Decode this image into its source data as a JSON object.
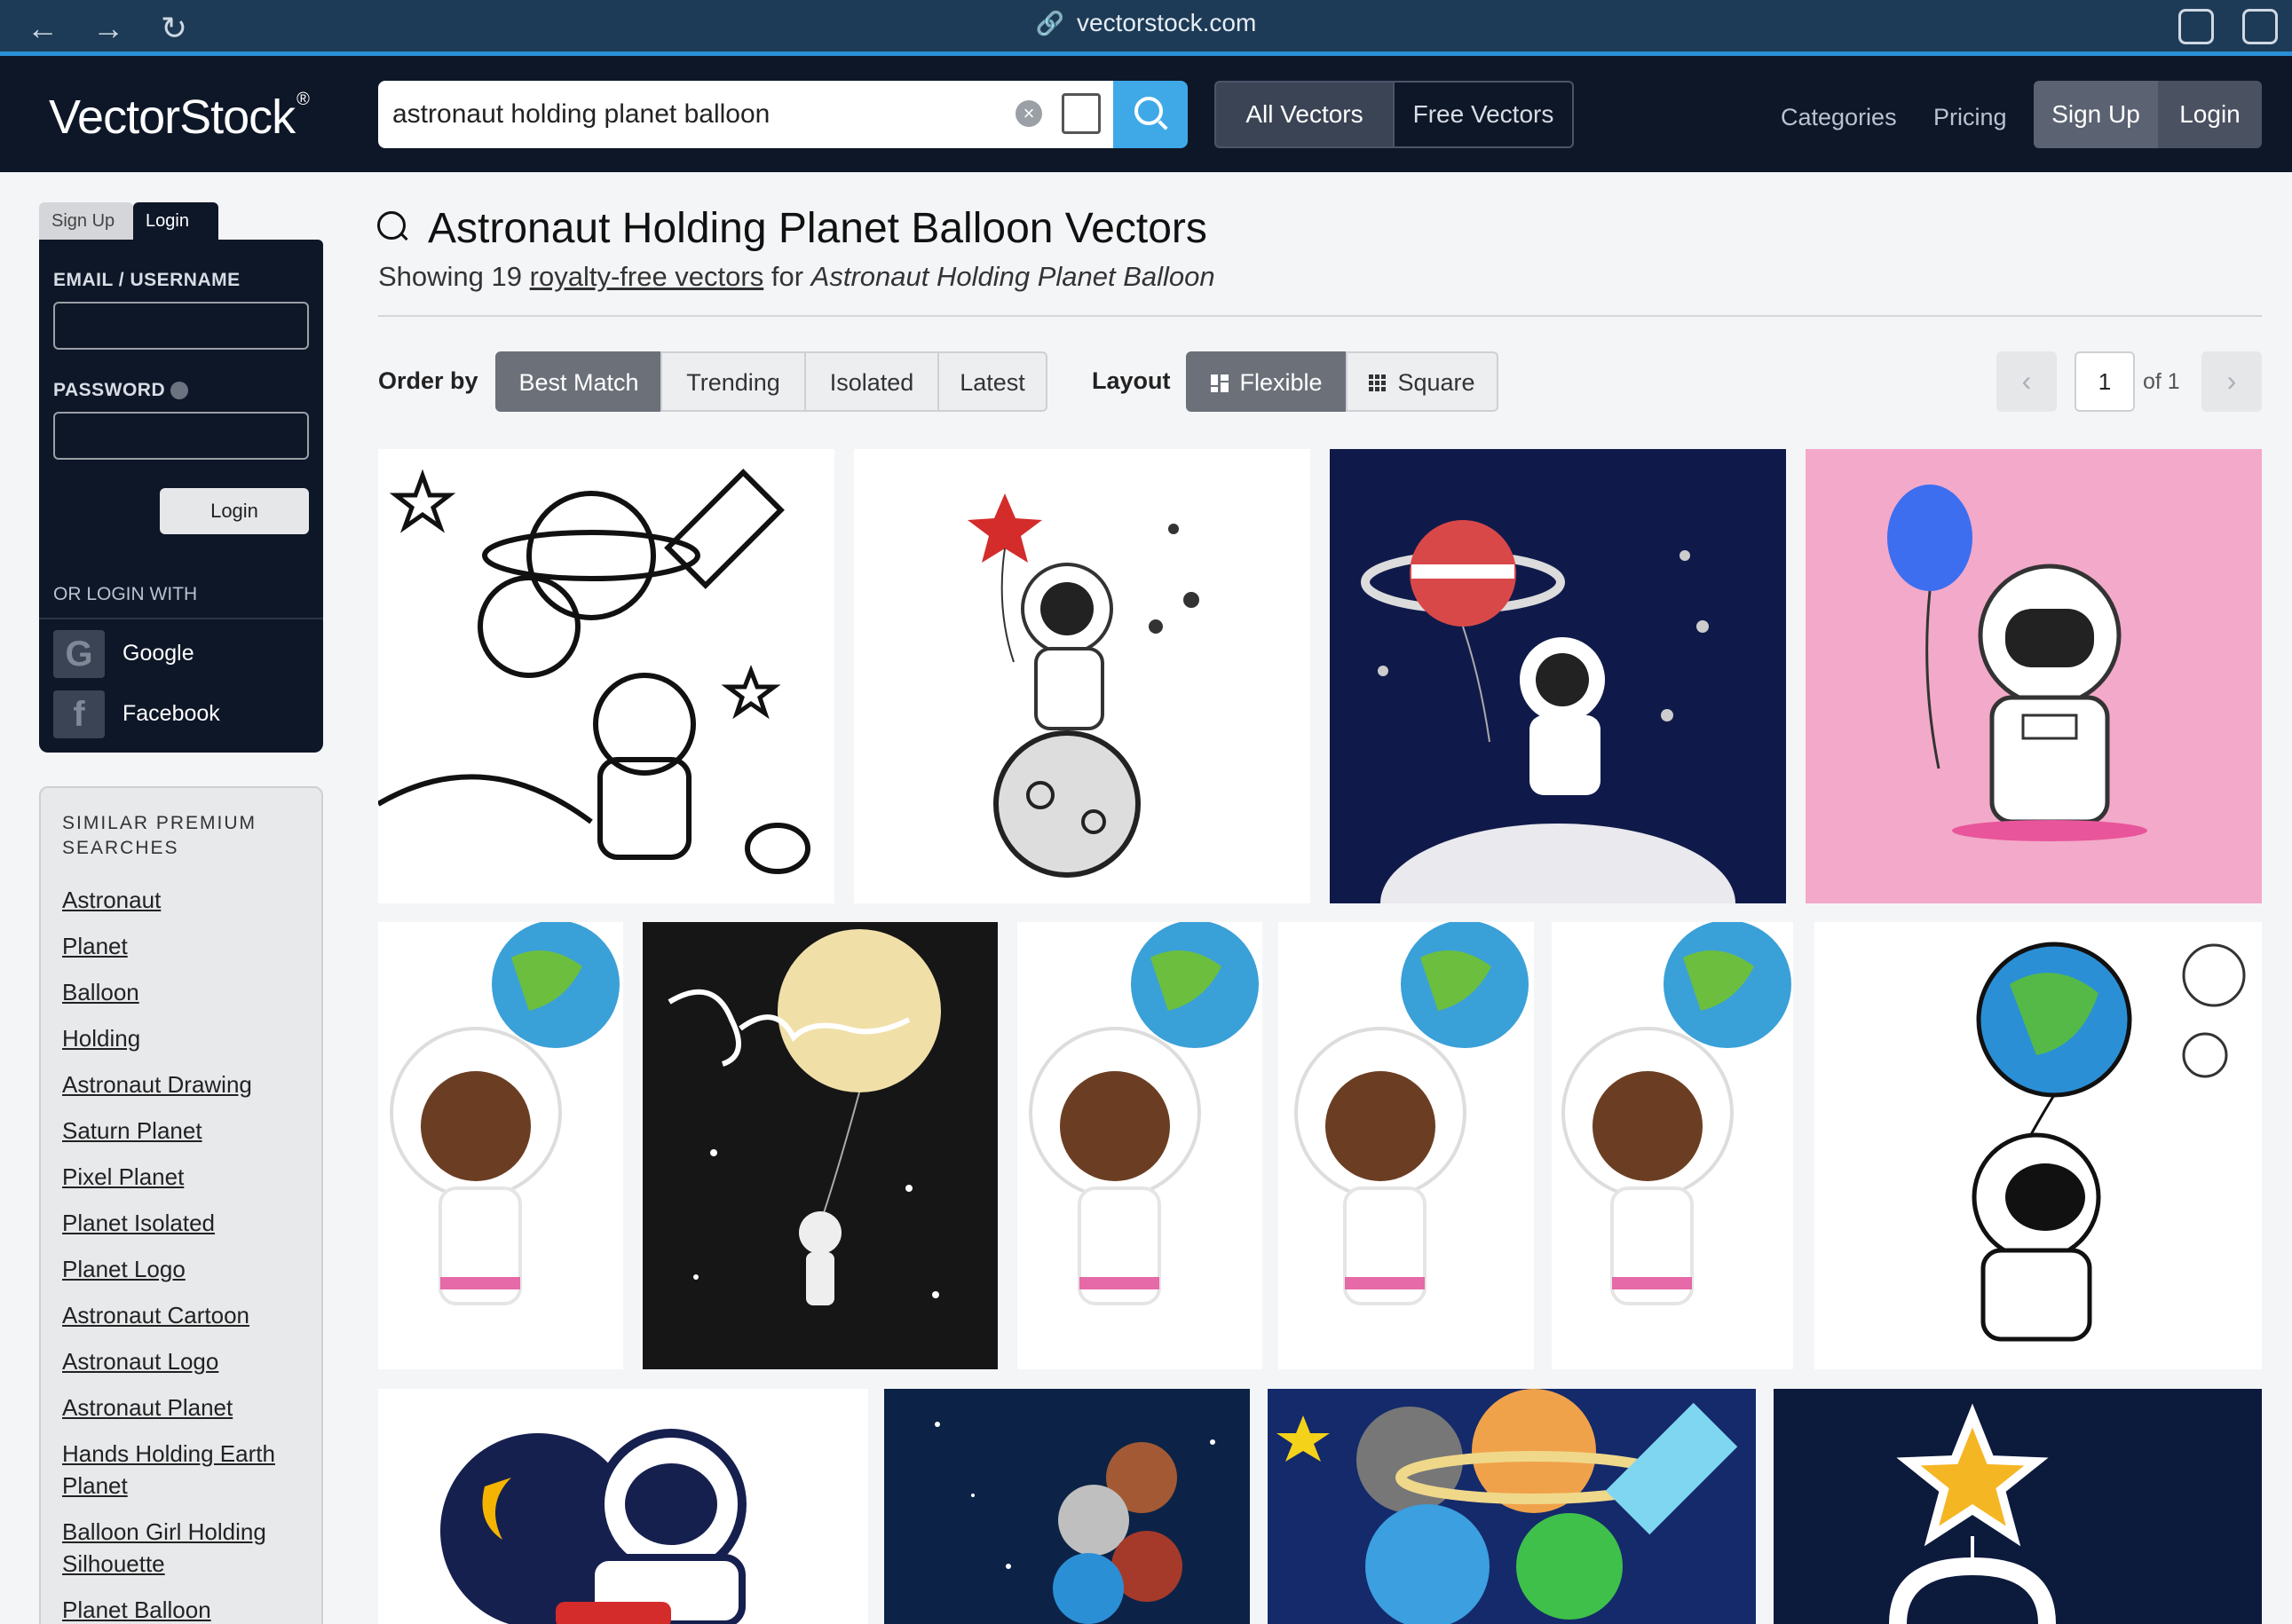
{
  "browser": {
    "url": "vectorstock.com"
  },
  "header": {
    "logo": "VectorStock",
    "logo_mark": "®",
    "search_value": "astronaut holding planet balloon",
    "all_vectors": "All Vectors",
    "free_vectors": "Free Vectors",
    "categories": "Categories",
    "pricing": "Pricing",
    "sign_up": "Sign Up",
    "login": "Login"
  },
  "sidebar": {
    "tab_signup": "Sign Up",
    "tab_login": "Login",
    "email_label": "EMAIL / USERNAME",
    "password_label": "PASSWORD",
    "login_button": "Login",
    "or_login_with": "OR LOGIN WITH",
    "google": "Google",
    "facebook": "Facebook",
    "similar_title": "SIMILAR PREMIUM SEARCHES",
    "similar": [
      "Astronaut",
      "Planet",
      "Balloon",
      "Holding",
      "Astronaut Drawing",
      "Saturn Planet",
      "Pixel Planet",
      "Planet Isolated",
      "Planet Logo",
      "Astronaut Cartoon",
      "Astronaut Logo",
      "Astronaut Planet",
      "Hands Holding Earth Planet",
      "Balloon Girl Holding Silhouette",
      "Planet Balloon"
    ]
  },
  "main": {
    "title": "Astronaut Holding Planet Balloon Vectors",
    "subtitle_prefix": "Showing 19",
    "subtitle_link": "royalty-free vectors",
    "subtitle_for": "for",
    "subtitle_query": "Astronaut Holding Planet Balloon",
    "order_by": "Order by",
    "order": [
      "Best Match",
      "Trending",
      "Isolated",
      "Latest"
    ],
    "layout": "Layout",
    "layout_options": [
      "Flexible",
      "Square"
    ],
    "page": "1",
    "of": "of 1",
    "images": [
      "line-art-astronaut-coloring",
      "astronaut-on-moon-star-balloon",
      "astronaut-saturn-balloon-navy",
      "astronaut-blue-balloon-pink",
      "girl-astronaut-earth-balloon-1",
      "space-lettering-moon-balloon",
      "girl-astronaut-earth-balloon-2",
      "girl-astronaut-earth-balloon-3",
      "girl-astronaut-earth-balloon-4",
      "astronaut-earth-balloon-sketch",
      "astronaut-hugging-planet",
      "planet-balloons-starry-sky",
      "planet-balloons-satellite",
      "astronaut-star-balloon-dark"
    ]
  },
  "colors": {
    "header_bg": "#0e1728",
    "accent": "#3fa9e8",
    "active_seg": "#6b7079"
  }
}
